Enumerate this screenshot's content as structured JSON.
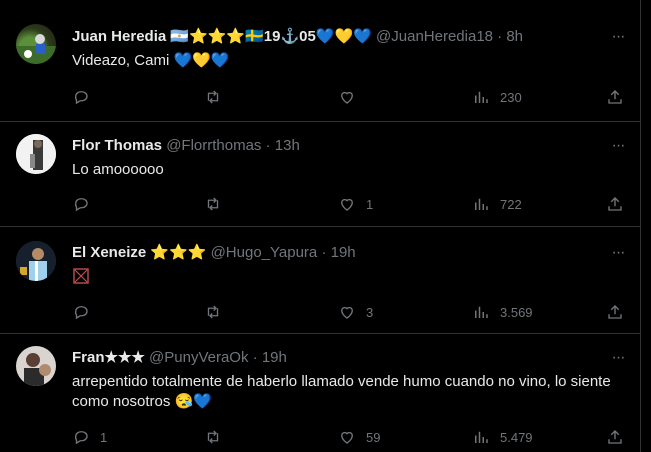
{
  "tweets": [
    {
      "name": "Juan Heredia",
      "badges": "🇦🇷⭐⭐⭐🇸🇪19⚓05💙💛💙",
      "handle": "@JuanHeredia18",
      "time": "· 8h",
      "text": "Videazo, Cami 💙💛💙",
      "replies": "",
      "retweets": "",
      "likes": "",
      "views": "230"
    },
    {
      "name": "Flor Thomas",
      "badges": "",
      "handle": "@Florrthomas",
      "time": "· 13h",
      "text": "Lo amoooooo",
      "replies": "",
      "retweets": "",
      "likes": "1",
      "views": "722"
    },
    {
      "name": "El Xeneize",
      "badges": "⭐⭐⭐",
      "handle": "@Hugo_Yapura",
      "time": "· 19h",
      "text": "",
      "replies": "",
      "retweets": "",
      "likes": "3",
      "views": "3.569"
    },
    {
      "name": "Fran★★★",
      "badges": "",
      "handle": "@PunyVeraOk",
      "time": "· 19h",
      "text": "arrepentido totalmente de haberlo llamado vende humo cuando no vino, lo siente como nosotros 😪💙",
      "replies": "1",
      "retweets": "",
      "likes": "59",
      "views": "5.479"
    }
  ],
  "icons": {
    "more": "more-icon",
    "reply": "reply-icon",
    "retweet": "retweet-icon",
    "like": "heart-icon",
    "views": "views-icon",
    "share": "share-icon"
  },
  "colors": {
    "text": "#e7e9ea",
    "muted": "#71767b",
    "border": "#2f3336",
    "background": "#000000"
  }
}
